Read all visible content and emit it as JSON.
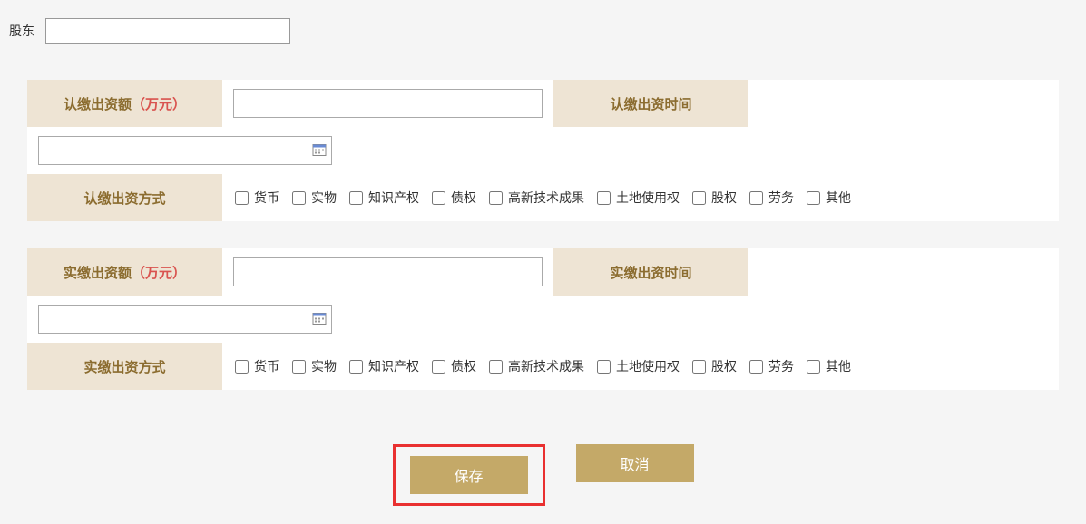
{
  "topField": {
    "label": "股东",
    "value": ""
  },
  "section1": {
    "amountLabel": "认缴出资额",
    "amountUnit": "（万元）",
    "amountValue": "",
    "timeLabel": "认缴出资时间",
    "timeValue": "",
    "methodLabel": "认缴出资方式"
  },
  "section2": {
    "amountLabel": "实缴出资额",
    "amountUnit": "（万元）",
    "amountValue": "",
    "timeLabel": "实缴出资时间",
    "timeValue": "",
    "methodLabel": "实缴出资方式"
  },
  "methodOptions": [
    "货币",
    "实物",
    "知识产权",
    "债权",
    "高新技术成果",
    "土地使用权",
    "股权",
    "劳务",
    "其他"
  ],
  "buttons": {
    "save": "保存",
    "cancel": "取消"
  },
  "icons": {
    "calendar": "calendar-icon"
  },
  "colors": {
    "labelBg": "#eee4d4",
    "labelText": "#8b6c2f",
    "unitRed": "#d9534f",
    "btn": "#c4a968",
    "highlight": "#e93030"
  }
}
